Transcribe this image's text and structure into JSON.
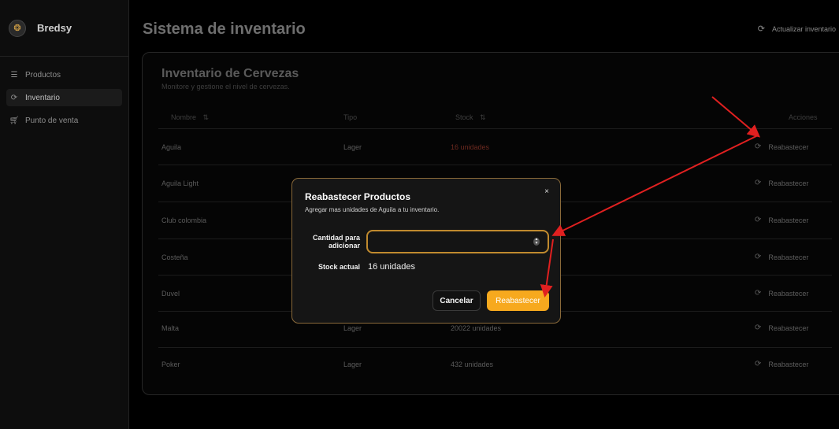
{
  "sidebar": {
    "brand": "Bredsy",
    "brand_icon": "lion-icon",
    "items": [
      {
        "label": "Productos",
        "icon": "database-icon",
        "active": false
      },
      {
        "label": "Inventario",
        "icon": "sync-icon",
        "active": true
      },
      {
        "label": "Punto de venta",
        "icon": "cart-icon",
        "active": false
      }
    ]
  },
  "header": {
    "title": "Sistema de inventario",
    "refresh_label": "Actualizar inventario"
  },
  "card": {
    "title": "Inventario de Cervezas",
    "subtitle": "Monitore y gestione el nivel de cervezas.",
    "columns": [
      "Nombre",
      "Tipo",
      "Stock",
      "Acciones"
    ],
    "rows": [
      {
        "name": "Aguila",
        "type": "Lager",
        "stock": "16 unidades",
        "action": "Reabastecer"
      },
      {
        "name": "Aguila Light",
        "type": "",
        "stock": "",
        "action": "Reabastecer"
      },
      {
        "name": "Club colombia",
        "type": "",
        "stock": "",
        "action": "Reabastecer"
      },
      {
        "name": "Costeña",
        "type": "",
        "stock": "",
        "action": "Reabastecer"
      },
      {
        "name": "Duvel",
        "type": "",
        "stock": "",
        "action": "Reabastecer"
      },
      {
        "name": "Malta",
        "type": "Lager",
        "stock": "20022 unidades",
        "action": "Reabastecer"
      },
      {
        "name": "Poker",
        "type": "Lager",
        "stock": "432 unidades",
        "action": "Reabastecer"
      }
    ]
  },
  "modal": {
    "title": "Reabastecer Productos",
    "subtitle": "Agregar mas unidades de Aguila a tu inventario.",
    "close": "×",
    "qty_label_1": "Cantidad para",
    "qty_label_2": "adicionar",
    "qty_value": "",
    "stock_label": "Stock actual",
    "stock_value": "16 unidades",
    "cancel": "Cancelar",
    "confirm": "Reabastecer"
  },
  "colors": {
    "accent": "#f7a91e",
    "annotation": "#e02020"
  }
}
